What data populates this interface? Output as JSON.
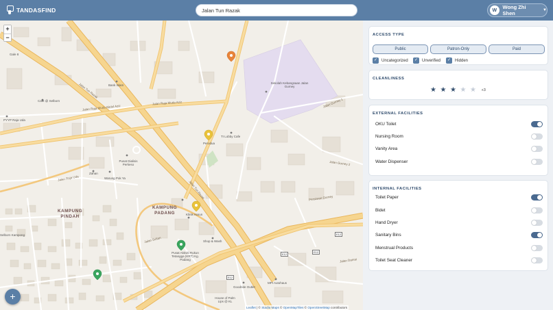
{
  "header": {
    "brand": "TANDASFIND",
    "search_value": "Jalan Tun Razak",
    "user_initial": "W",
    "user_name": "Wong Zhi Shen"
  },
  "map": {
    "zoom_in": "+",
    "zoom_out": "−",
    "fab_label": "+",
    "attribution": {
      "leaflet": "Leaflet",
      "sep1": " | © ",
      "stadia": "Stadia Maps",
      "sep2": " © ",
      "omt": "OpenMapTiles",
      "sep3": " © ",
      "osm": "OpenStreetMap",
      "contrib": " contributors"
    },
    "labels": {
      "kampung_pindah_1": "KAMPUNG",
      "kampung_pindah_2": "PINDAH",
      "kampung_padang_1": "KAMPUNG",
      "kampung_padang_2": "PADANG",
      "jalan_tun_razak": "Jalan Tun Razak",
      "jalan_raja_muda": "Jalan Raja Muda Abdul Aziz",
      "jalan_raja_muda_2": "Jalan Raja Muda Aziz",
      "jalan_raja_uda": "Jalan Raja Uda",
      "jalan_gurney": "Jalan Gurney 1",
      "jalan_gurney_2": "Jalan Gurney 2",
      "persiaran_gurney": "Persiaran Gurney",
      "jalan_sultan": "Jalan Sultan",
      "jalan_damai": "Jalan Damai",
      "sekolah": "Sekolah Kebangsaan Jalan Gurney",
      "bank_islam": "Bank Islam",
      "cafe": "Cafe @ Selborn",
      "pyyp": "PYYP Raja Uda",
      "perodua": "Perodua",
      "ti_lobby": "TI Lobby Cafe",
      "klinik": "Klinik Harun",
      "shop": "Shop & Wash",
      "pusat": "Pusat Aktiviti Rukun Tetangga (KRT) Kg. Padang",
      "mpi": "MPI Autohaus",
      "goodride": "Goodride Outlet",
      "house": "House of Palm Lips @ KL",
      "zahan": "Zahan",
      "warung": "Warung Pok Ya",
      "pusat_dialisis": "Pusat Dialisis Perkeso",
      "gale": "Gale 8",
      "selborn": "Selborn Kampong",
      "e12": "E12",
      "e12b": "E12",
      "e12c": "E12",
      "e12d": "E12"
    }
  },
  "access_type": {
    "title": "ACCESS TYPE",
    "options": [
      "Public",
      "Patron-Only",
      "Paid"
    ],
    "checks": [
      {
        "label": "Uncategorized",
        "checked": true
      },
      {
        "label": "Unverified",
        "checked": true
      },
      {
        "label": "Hidden",
        "checked": true
      }
    ],
    "check_glyph": "✓"
  },
  "cleanliness": {
    "title": "CLEANLINESS",
    "rating": 3,
    "max": 5,
    "star_glyph": "★",
    "suffix": "+3"
  },
  "external": {
    "title": "EXTERNAL FACILITIES",
    "items": [
      {
        "label": "OKU Toilet",
        "on": true
      },
      {
        "label": "Nursing Room",
        "on": false
      },
      {
        "label": "Vanity Area",
        "on": false
      },
      {
        "label": "Water Dispenser",
        "on": false
      }
    ]
  },
  "internal": {
    "title": "INTERNAL FACILITIES",
    "items": [
      {
        "label": "Toilet Paper",
        "on": true
      },
      {
        "label": "Bidet",
        "on": false
      },
      {
        "label": "Hand Dryer",
        "on": false
      },
      {
        "label": "Sanitary Bins",
        "on": true
      },
      {
        "label": "Menstrual Products",
        "on": false
      },
      {
        "label": "Toilet Seat Cleaner",
        "on": false
      }
    ]
  },
  "colors": {
    "header": "#5b7fa6",
    "accent": "#4a6a90",
    "pin_orange": "#e8843a",
    "pin_yellow": "#e9c23a",
    "pin_green": "#3aa55e",
    "road_major": "#f6d58f",
    "school_area": "#e4dcef"
  }
}
